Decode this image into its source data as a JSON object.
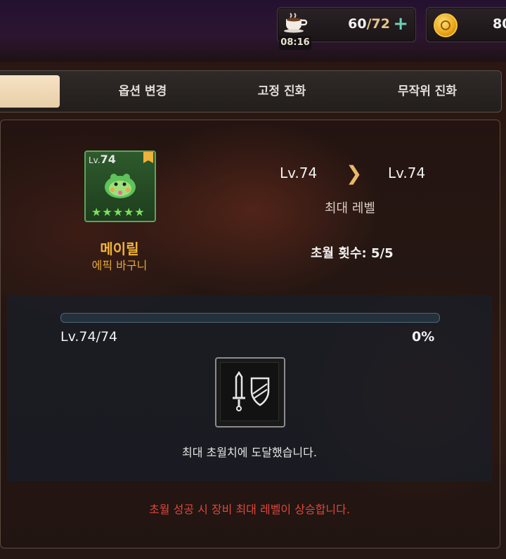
{
  "resources": {
    "stamina_current": "60",
    "stamina_sep": "/",
    "stamina_max": "72",
    "stamina_plus": "+",
    "timer": "08:16",
    "gold": "80",
    "icons": [
      "coffee-cup-icon",
      "gold-coin-icon",
      "plus-icon"
    ]
  },
  "tabs": [
    {
      "label": "",
      "active": true
    },
    {
      "label": "옵션 변경",
      "active": false
    },
    {
      "label": "고정 진화",
      "active": false
    },
    {
      "label": "무작위 진화",
      "active": false
    }
  ],
  "item": {
    "lv_prefix": "Lv.",
    "lv_value": "74",
    "stars": "★★★★★",
    "name": "메이릴",
    "type": "에픽 바구니",
    "grade_color": "#f0b43a"
  },
  "level": {
    "from": "Lv.74",
    "arrow": "❯",
    "to": "Lv.74",
    "max_label": "최대 레벨",
    "transcend_count": "초월 횟수: 5/5"
  },
  "progress": {
    "level_text": "Lv.74/74",
    "percent_text": "0%",
    "fraction": 0
  },
  "messages": {
    "max_reached": "최대 초월치에 도달했습니다.",
    "notice": "초월 성공 시 장비 최대 레벨이 상승합니다."
  }
}
